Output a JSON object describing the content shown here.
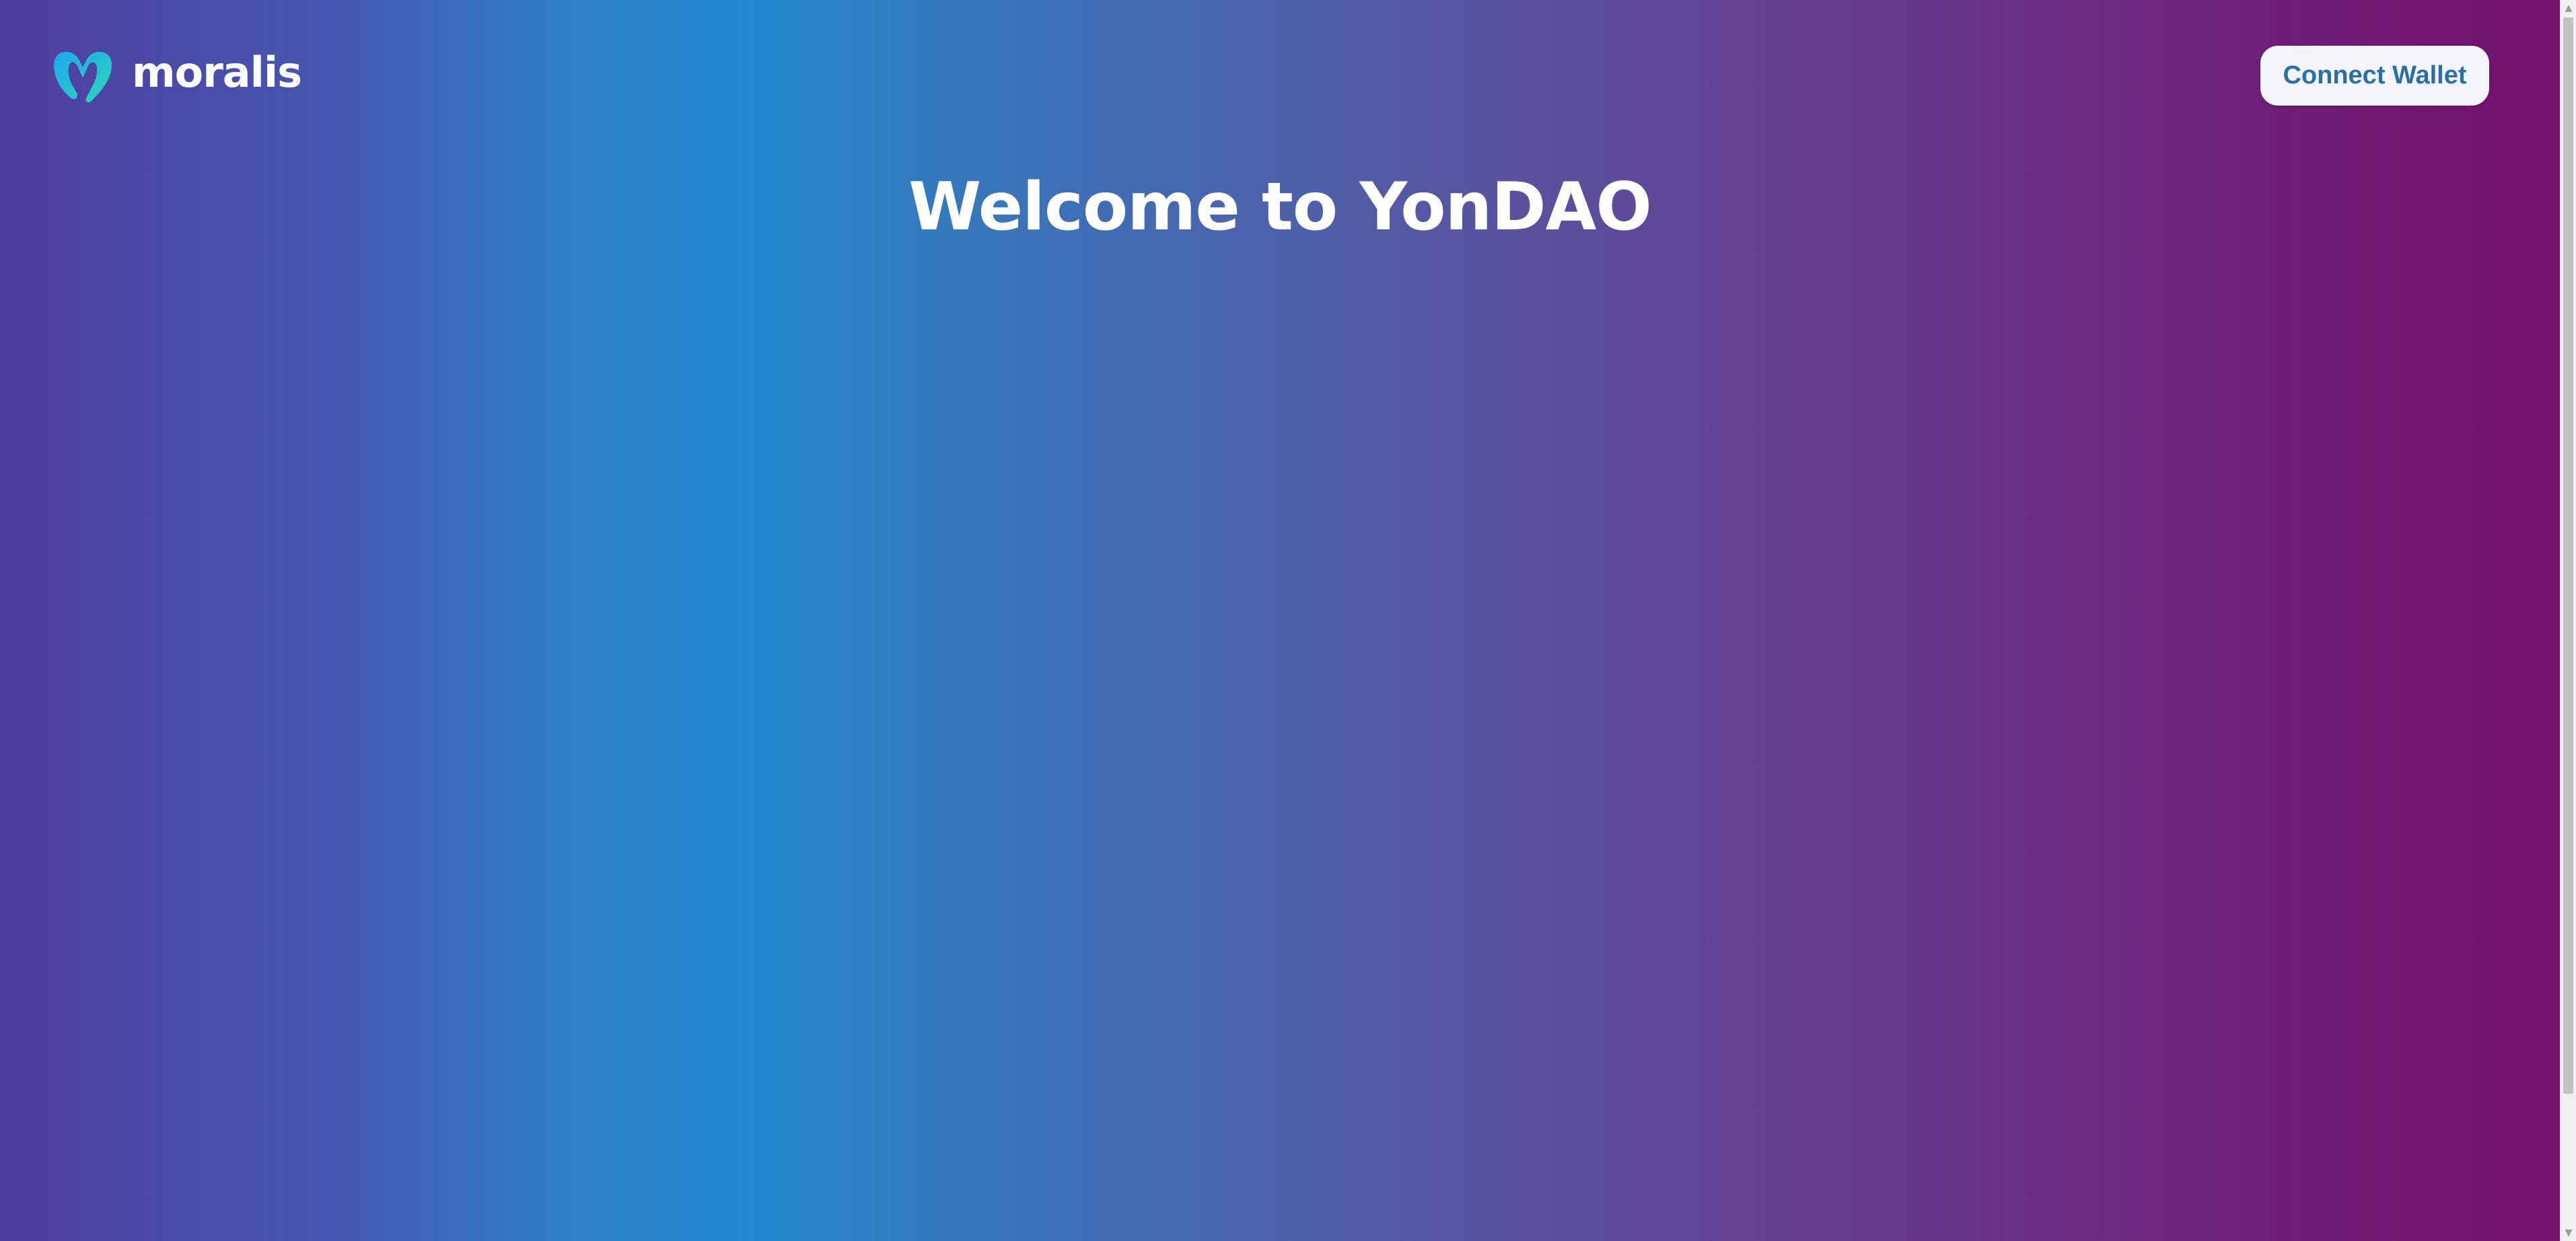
{
  "header": {
    "logo": {
      "icon": "moralis-logo-icon",
      "text": "moralis"
    },
    "connect_button_label": "Connect Wallet"
  },
  "main": {
    "title": "Welcome to YonDAO"
  },
  "colors": {
    "gradient_left": "#4f3d9f",
    "gradient_mid": "#2389cf",
    "gradient_right": "#75116c",
    "button_text": "#2b6fa6",
    "logo_gradient_start": "#1fb0f0",
    "logo_gradient_end": "#2dd3b8"
  },
  "scrollbar": {
    "up_icon": "triangle-up-icon",
    "down_icon": "triangle-down-icon"
  }
}
